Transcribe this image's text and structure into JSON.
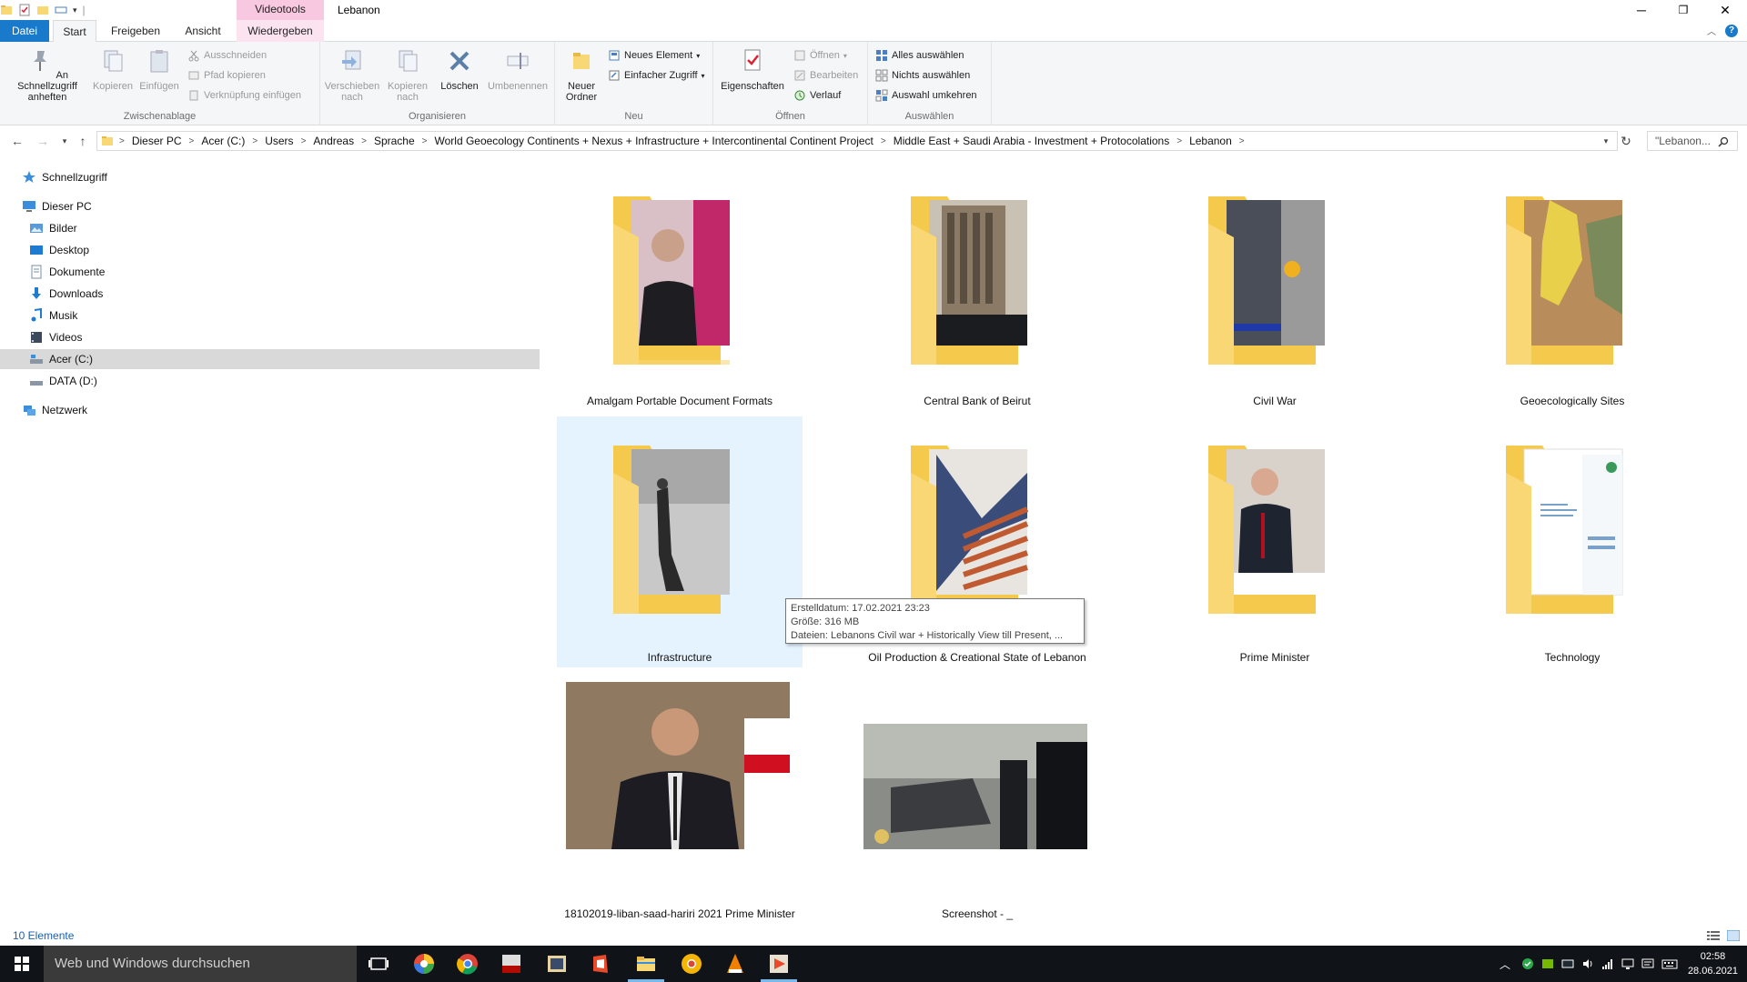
{
  "window": {
    "title": "Lebanon",
    "context_tab_label": "Videotools",
    "minimize_glyph": "─",
    "maximize_glyph": "❐",
    "close_glyph": "✕"
  },
  "ribbon_tabs": [
    {
      "label": "Datei"
    },
    {
      "label": "Start"
    },
    {
      "label": "Freigeben"
    },
    {
      "label": "Ansicht"
    },
    {
      "label": "Wiedergeben"
    }
  ],
  "ribbon": {
    "clipboard": {
      "group_label": "Zwischenablage",
      "pin_label": "An Schnellzugriff anheften",
      "copy_label": "Kopieren",
      "paste_label": "Einfügen",
      "cut_label": "Ausschneiden",
      "copy_path_label": "Pfad kopieren",
      "paste_shortcut_label": "Verknüpfung einfügen"
    },
    "organize": {
      "group_label": "Organisieren",
      "move_label": "Verschieben nach",
      "copy_to_label": "Kopieren nach",
      "delete_label": "Löschen",
      "rename_label": "Umbenennen"
    },
    "new": {
      "group_label": "Neu",
      "new_folder_label": "Neuer Ordner",
      "new_item_label": "Neues Element",
      "easy_access_label": "Einfacher Zugriff"
    },
    "open": {
      "group_label": "Öffnen",
      "properties_label": "Eigenschaften",
      "open_label": "Öffnen",
      "edit_label": "Bearbeiten",
      "history_label": "Verlauf"
    },
    "select": {
      "group_label": "Auswählen",
      "select_all_label": "Alles auswählen",
      "select_none_label": "Nichts auswählen",
      "invert_label": "Auswahl umkehren"
    }
  },
  "address": {
    "crumbs": [
      "Dieser PC",
      "Acer (C:)",
      "Users",
      "Andreas",
      "Sprache",
      "World Geoecology Continents + Nexus + Infrastructure + Intercontinental Continent Project",
      "Middle East + Saudi Arabia - Investment + Protocolations",
      "Lebanon"
    ],
    "search_placeholder": "\"Lebanon..."
  },
  "nav_pane": {
    "quick_access": "Schnellzugriff",
    "this_pc": "Dieser PC",
    "items": [
      {
        "label": "Bilder",
        "icon": "pictures-icon"
      },
      {
        "label": "Desktop",
        "icon": "desktop-icon"
      },
      {
        "label": "Dokumente",
        "icon": "documents-icon"
      },
      {
        "label": "Downloads",
        "icon": "downloads-icon"
      },
      {
        "label": "Musik",
        "icon": "music-icon"
      },
      {
        "label": "Videos",
        "icon": "videos-icon"
      },
      {
        "label": "Acer (C:)",
        "icon": "drive-c-icon"
      },
      {
        "label": "DATA (D:)",
        "icon": "drive-d-icon"
      }
    ],
    "network": "Netzwerk"
  },
  "items": [
    {
      "name": "Amalgam Portable Document Formats",
      "type": "folder"
    },
    {
      "name": "Central Bank of Beirut",
      "type": "folder"
    },
    {
      "name": "Civil War",
      "type": "folder"
    },
    {
      "name": "Geoecologically Sites",
      "type": "folder"
    },
    {
      "name": "Infrastructure",
      "type": "folder"
    },
    {
      "name": "Oil Production & Creational State of Lebanon",
      "type": "folder"
    },
    {
      "name": "Prime Minister",
      "type": "folder"
    },
    {
      "name": "Technology",
      "type": "folder"
    },
    {
      "name": "18102019-liban-saad-hariri 2021 Prime Minister",
      "type": "image"
    },
    {
      "name": "Screenshot - _",
      "type": "image"
    }
  ],
  "tooltip": {
    "line1": "Erstelldatum: 17.02.2021 23:23",
    "line2": "Größe: 316 MB",
    "line3": "Dateien: Lebanons Civil war + Historically View till Present, ..."
  },
  "status": {
    "count": "10 Elemente"
  },
  "taskbar": {
    "search_placeholder": "Web und Windows durchsuchen",
    "time": "02:58",
    "date": "28.06.2021"
  },
  "colors": {
    "accent": "#1979ca",
    "folder": "#f8d775",
    "selection": "#e5f3ff",
    "taskbar": "#101419"
  }
}
